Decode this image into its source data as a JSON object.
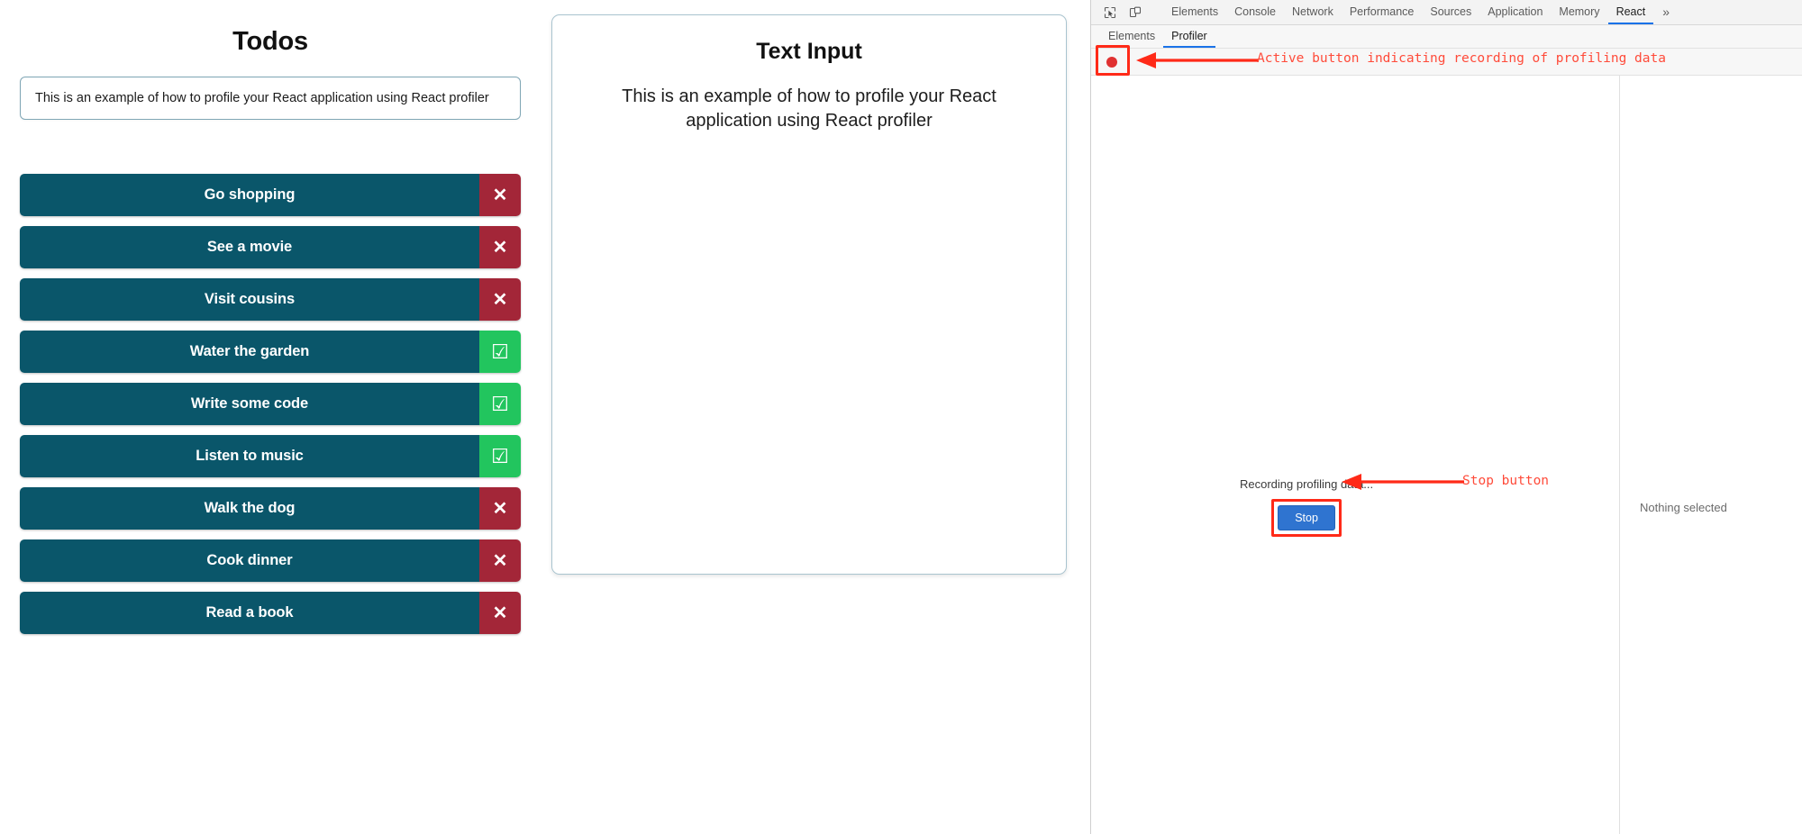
{
  "app": {
    "todos_panel": {
      "title": "Todos",
      "input_value": "This is an example of how to profile your React application using React profiler",
      "input_placeholder": "",
      "items": [
        {
          "label": "Go shopping",
          "state": "pending",
          "action_icon": "✕"
        },
        {
          "label": "See a movie",
          "state": "pending",
          "action_icon": "✕"
        },
        {
          "label": "Visit cousins",
          "state": "pending",
          "action_icon": "✕"
        },
        {
          "label": "Water the garden",
          "state": "completed",
          "action_icon": "☑"
        },
        {
          "label": "Write some code",
          "state": "completed",
          "action_icon": "☑"
        },
        {
          "label": "Listen to music",
          "state": "completed",
          "action_icon": "☑"
        },
        {
          "label": "Walk the dog",
          "state": "pending",
          "action_icon": "✕"
        },
        {
          "label": "Cook dinner",
          "state": "pending",
          "action_icon": "✕"
        },
        {
          "label": "Read a book",
          "state": "pending",
          "action_icon": "✕"
        }
      ]
    },
    "text_panel": {
      "title": "Text Input",
      "body": "This is an example of how to profile your React application using React profiler"
    }
  },
  "devtools": {
    "toolbar_icons": [
      "inspect-element-icon",
      "device-toolbar-icon"
    ],
    "tabs": [
      {
        "label": "Elements",
        "active": false
      },
      {
        "label": "Console",
        "active": false
      },
      {
        "label": "Network",
        "active": false
      },
      {
        "label": "Performance",
        "active": false
      },
      {
        "label": "Sources",
        "active": false
      },
      {
        "label": "Application",
        "active": false
      },
      {
        "label": "Memory",
        "active": false
      },
      {
        "label": "React",
        "active": true
      }
    ],
    "more_tabs_label": "»",
    "subtabs": [
      {
        "label": "Elements",
        "active": false
      },
      {
        "label": "Profiler",
        "active": true
      }
    ],
    "profiler": {
      "record_button_name": "record-profiling-button",
      "recording_status": "Recording profiling data...",
      "stop_button_label": "Stop",
      "sidebar_empty_text": "Nothing selected"
    }
  },
  "annotations": [
    {
      "text": "Active button indicating recording of profiling data",
      "target": "record-profiling-button"
    },
    {
      "text": "Stop button",
      "target": "stop-button"
    }
  ],
  "colors": {
    "todo_bar": "#0a566a",
    "todo_delete": "#a32638",
    "todo_done": "#22c55e",
    "annotation": "#ff2a18",
    "devtools_accent": "#1a73e8",
    "stop_button": "#2f74d0"
  }
}
